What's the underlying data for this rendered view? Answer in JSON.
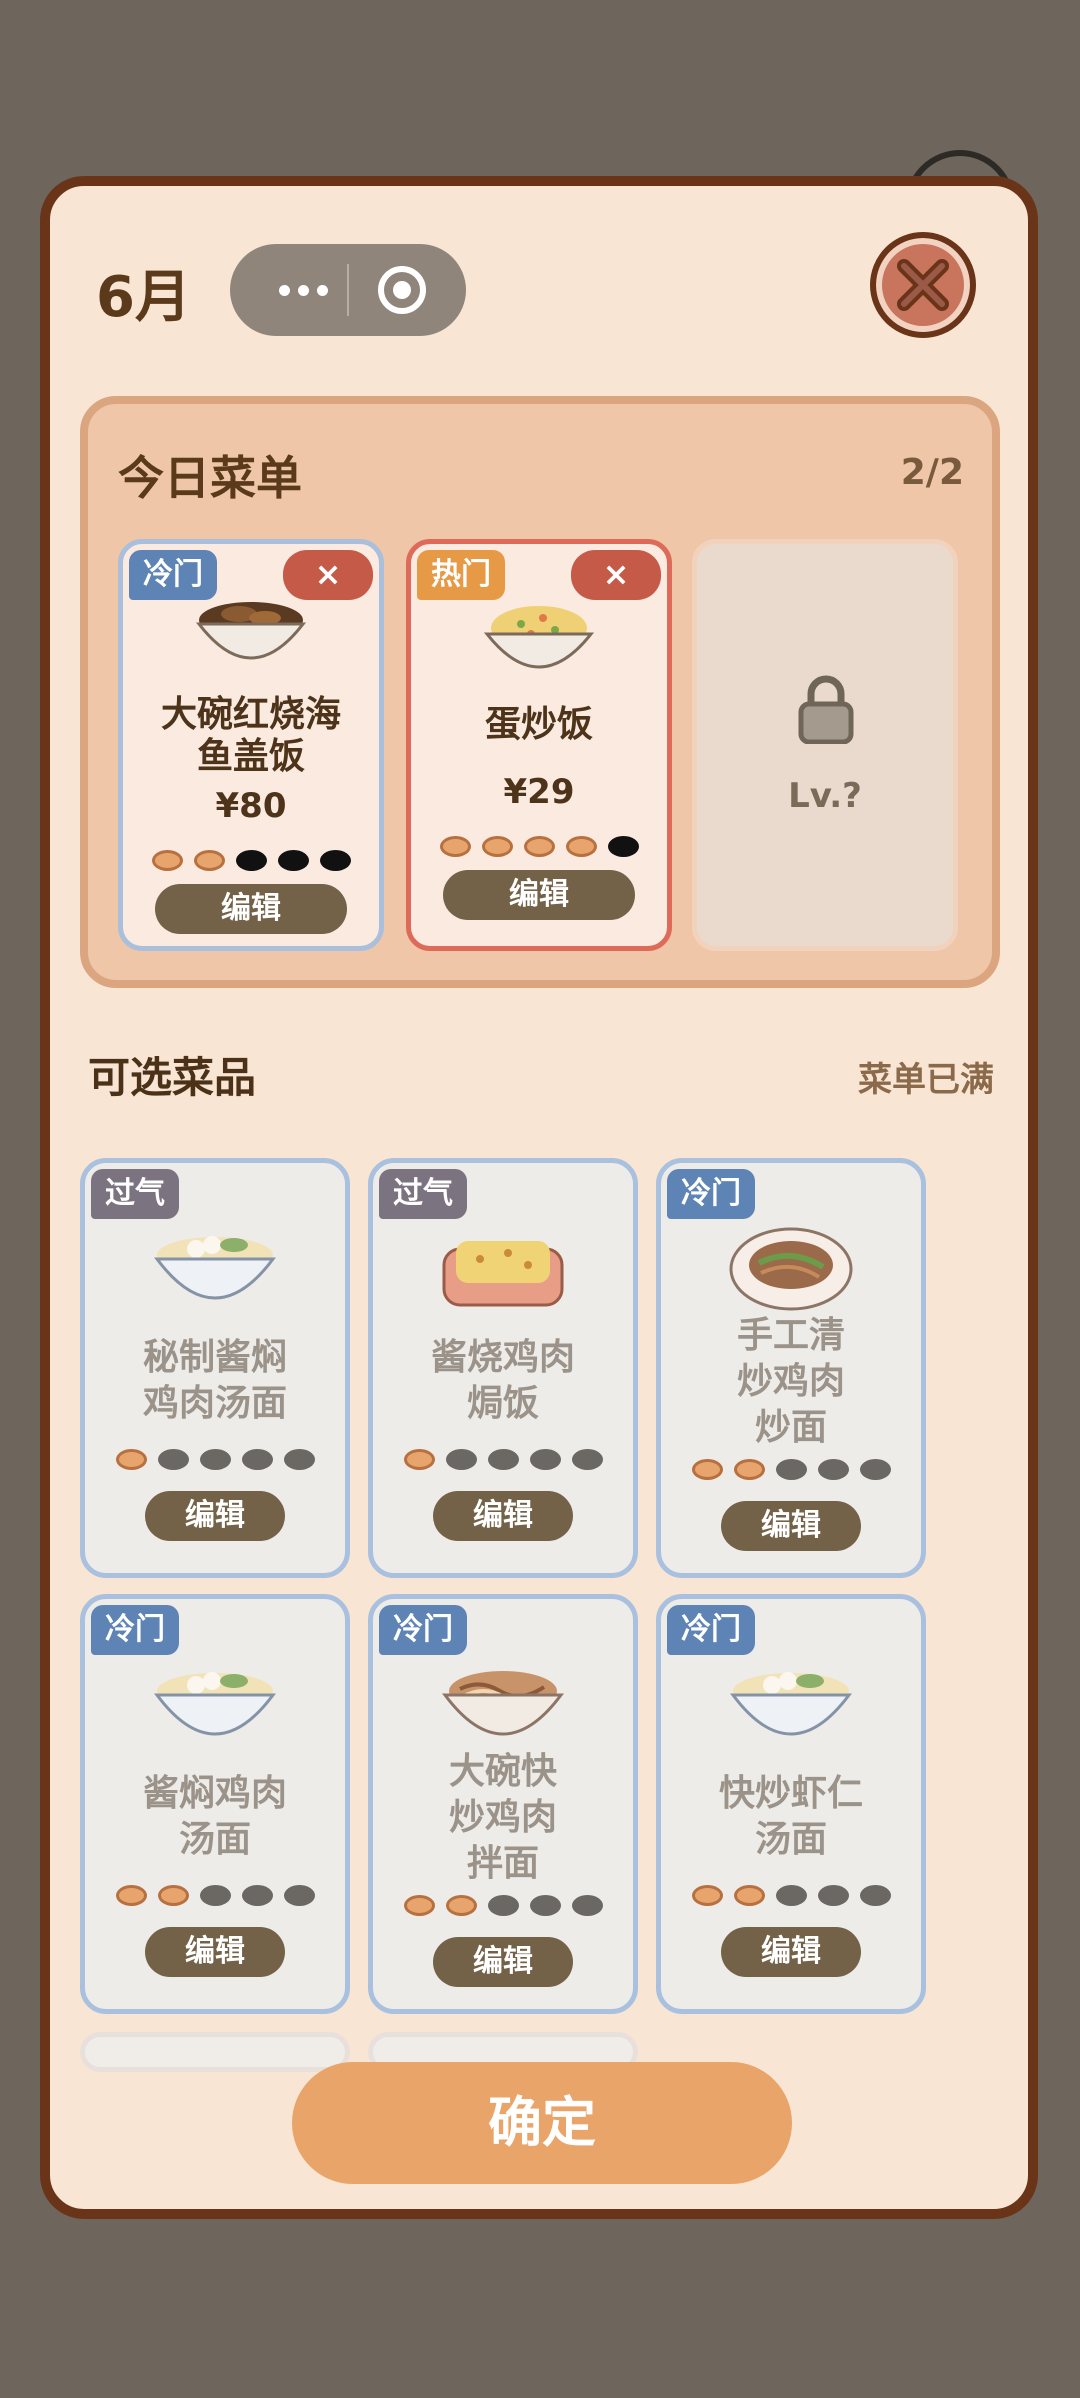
{
  "header": {
    "month": "6月"
  },
  "today_menu": {
    "title": "今日菜单",
    "count": "2/2",
    "cards": [
      {
        "tag": "冷门",
        "name": "大碗红烧海鱼盖饭",
        "price": "¥80",
        "rating": 2,
        "rating_max": 5,
        "edit_label": "编辑",
        "remove_label": "×"
      },
      {
        "tag": "热门",
        "name": "蛋炒饭",
        "price": "¥29",
        "rating": 4,
        "rating_max": 5,
        "edit_label": "编辑",
        "remove_label": "×"
      }
    ],
    "locked_slot": {
      "label": "Lv.?"
    }
  },
  "optional": {
    "title": "可选菜品",
    "status": "菜单已满",
    "items": [
      {
        "tag": "过气",
        "name": "秘制酱焖鸡肉汤面",
        "rating": 1,
        "edit_label": "编辑"
      },
      {
        "tag": "过气",
        "name": "酱烧鸡肉焗饭",
        "rating": 1,
        "edit_label": "编辑"
      },
      {
        "tag": "冷门",
        "name": "手工清炒鸡肉炒面",
        "rating": 2,
        "edit_label": "编辑"
      },
      {
        "tag": "冷门",
        "name": "酱焖鸡肉汤面",
        "rating": 2,
        "edit_label": "编辑"
      },
      {
        "tag": "冷门",
        "name": "大碗快炒鸡肉拌面",
        "rating": 2,
        "edit_label": "编辑"
      },
      {
        "tag": "冷门",
        "name": "快炒虾仁汤面",
        "rating": 2,
        "edit_label": "编辑"
      }
    ]
  },
  "confirm_label": "确定",
  "colors": {
    "cold_tag": "#5e84b5",
    "hot_tag": "#e79a45",
    "stale_tag": "#7b7480",
    "confirm": "#e9a46a"
  }
}
